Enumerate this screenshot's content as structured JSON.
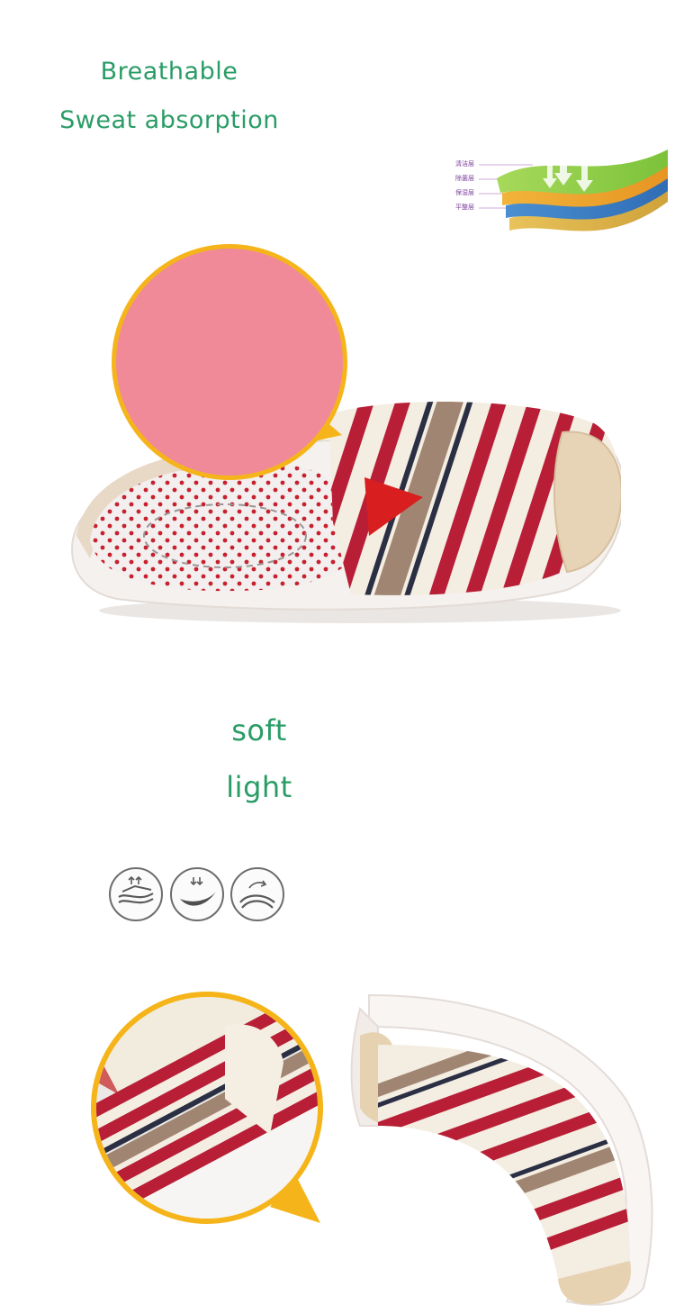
{
  "section1": {
    "features": [
      "Breathable",
      "Sweat absorption"
    ],
    "layer_labels": [
      "清洁层",
      "除菌层",
      "保湿层",
      "平整层"
    ]
  },
  "section2": {
    "features": [
      "soft",
      "light"
    ],
    "icons": [
      "breathable-layers-icon",
      "cushion-icon",
      "flexible-sole-icon"
    ]
  },
  "colors": {
    "text_green": "#2a9c66",
    "badge_yellow": "#f5b51a",
    "badge_pink": "#f08a98",
    "stripe_red": "#b81f36",
    "stripe_tan": "#a08672",
    "stripe_navy": "#2b2f44",
    "canvas_cream": "#f4ede2"
  }
}
